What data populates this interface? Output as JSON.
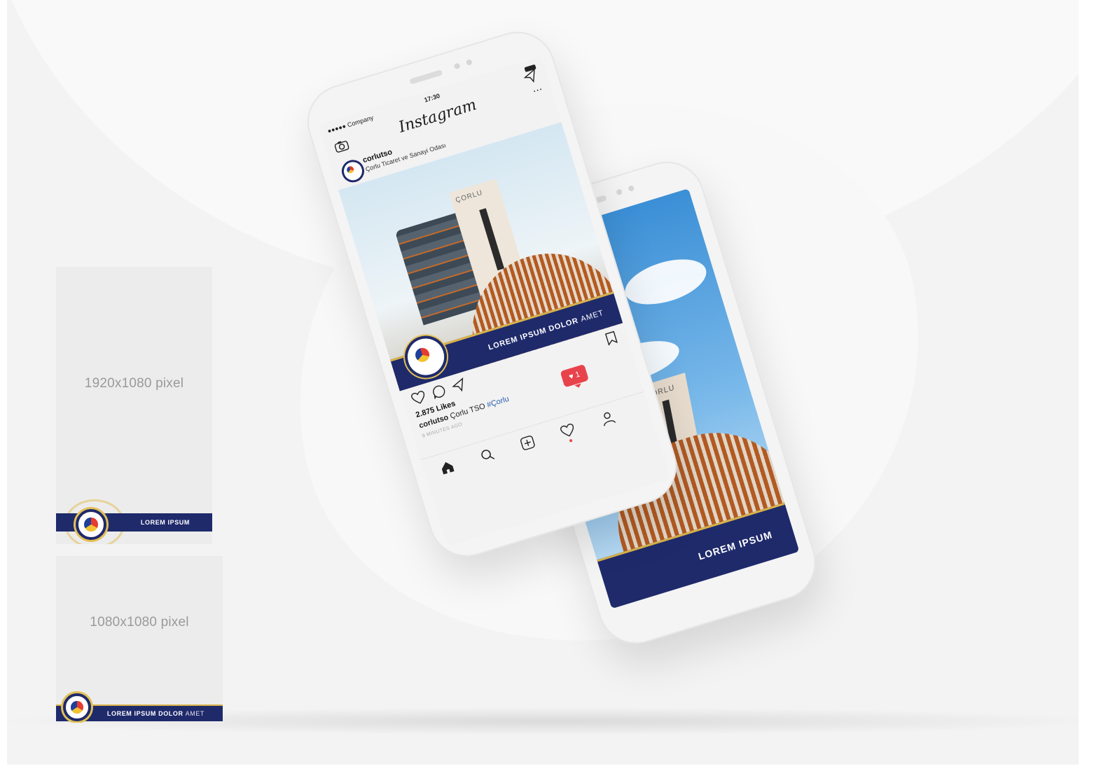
{
  "cards": {
    "story": {
      "size_label": "1920x1080  pixel",
      "band_text": "LOREM IPSUM"
    },
    "square": {
      "size_label": "1080x1080  pixel",
      "band_text": "LOREM IPSUM DOLOR",
      "band_suffix": "AMET"
    }
  },
  "back_phone": {
    "band_text": "LOREM IPSUM",
    "tower_name": "ÇORLU"
  },
  "front_phone": {
    "status": {
      "carrier": "●●●●● Company",
      "time": "17:30"
    },
    "app_title": "Instagram",
    "post": {
      "username": "corlutso",
      "subtitle": "Çorlu Ticaret ve Sanayi Odası",
      "tower_name": "ÇORLU",
      "band_text": "LOREM IPSUM DOLOR",
      "band_suffix": "AMET",
      "likes": "2.875 Likes",
      "caption_user": "corlutso",
      "caption_text": "Çorlu TSO",
      "caption_tag": "#Çorlu",
      "time_ago": "8 MINUTES AGO"
    },
    "notification_count": "1"
  },
  "icons": {
    "camera": "camera-icon",
    "send": "send-icon",
    "more": "more-icon",
    "heart": "heart-icon",
    "comment": "comment-icon",
    "bookmark": "bookmark-icon",
    "home": "home-icon",
    "search": "search-icon",
    "add": "add-icon",
    "profile": "profile-icon"
  },
  "colors": {
    "brand_navy": "#1f2a6b",
    "gold": "#d9b24a",
    "notify_red": "#e8434c"
  }
}
